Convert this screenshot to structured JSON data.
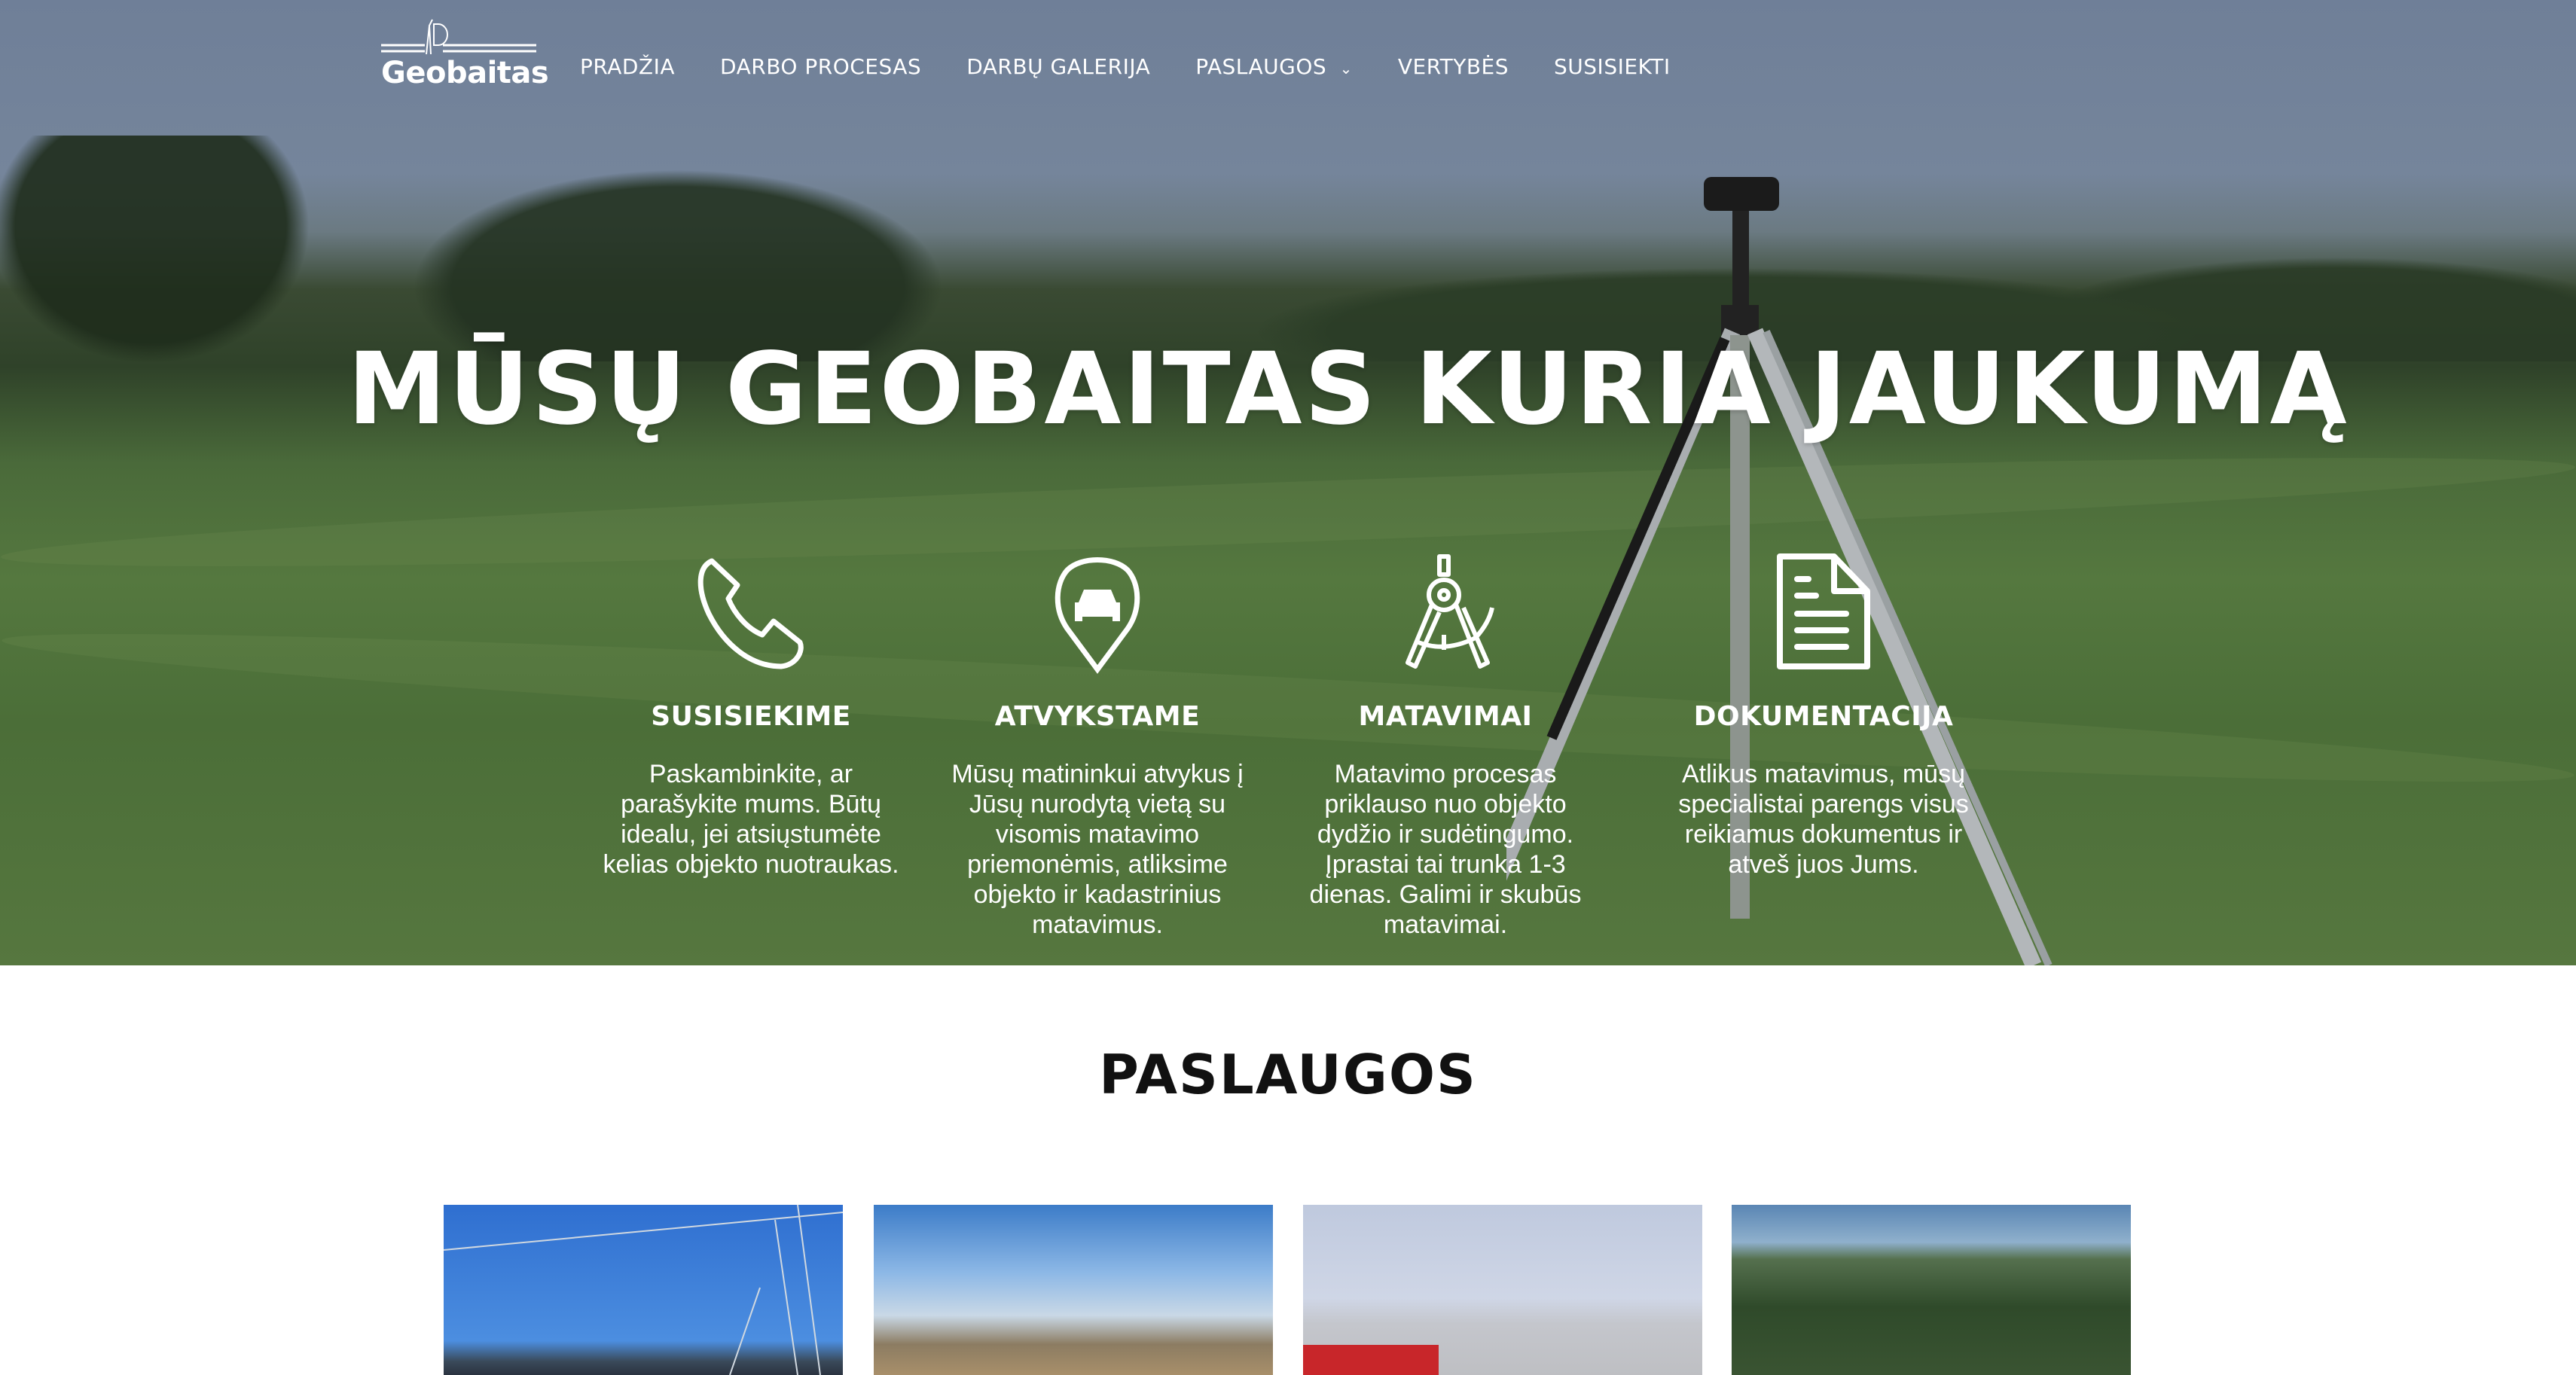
{
  "brand": {
    "name": "Geobaitas"
  },
  "nav": {
    "items": [
      {
        "label": "PRADŽIA"
      },
      {
        "label": "DARBO PROCESAS"
      },
      {
        "label": "DARBŲ GALERIJA"
      },
      {
        "label": "PASLAUGOS",
        "dropdown": true
      },
      {
        "label": "VERTYBĖS"
      },
      {
        "label": "SUSISIEKTI"
      }
    ]
  },
  "hero": {
    "title": "MŪSŲ GEOBAITAS KURIA JAUKUMĄ",
    "features": [
      {
        "icon": "phone-icon",
        "title": "SUSISIEKIME",
        "text": "Paskambinkite, ar parašykite mums. Būtų idealu, jei atsiųstumėte kelias objekto nuotraukas."
      },
      {
        "icon": "map-pin-car-icon",
        "title": "ATVYKSTAME",
        "text": "Mūsų matininkui atvykus į Jūsų nurodytą vietą su visomis matavimo priemonėmis, atliksime objekto ir kadastrinius matavimus."
      },
      {
        "icon": "compass-icon",
        "title": "MATAVIMAI",
        "text": "Matavimo procesas priklauso nuo objekto dydžio ir sudėtingumo. Įprastai tai trunka 1-3 dienas. Galimi ir skubūs matavimai."
      },
      {
        "icon": "document-icon",
        "title": "DOKUMENTACIJA",
        "text": "Atlikus matavimus, mūsų specialistai parengs visus reikiamus dokumentus ir atveš juos Jums."
      }
    ]
  },
  "services": {
    "title": "PASLAUGOS"
  }
}
